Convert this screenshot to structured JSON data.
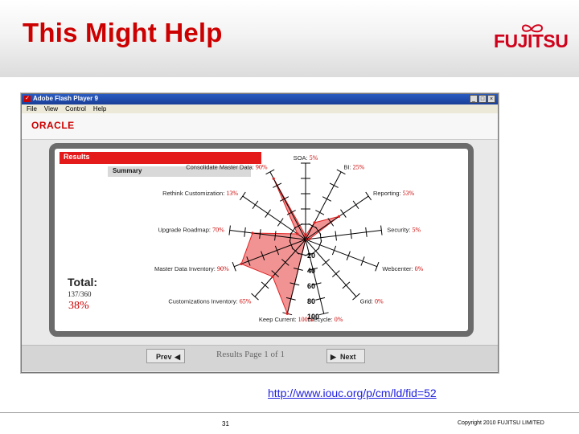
{
  "slide": {
    "title": "This Might Help",
    "logo_text": "FUJITSU",
    "url": "http://www.iouc.org/p/cm/ld/fid=52",
    "page_number": "31",
    "copyright": "Copyright 2010 FUJITSU LIMITED"
  },
  "window": {
    "title": "Adobe Flash Player 9",
    "menu": [
      "File",
      "View",
      "Control",
      "Help"
    ],
    "buttons": [
      "_",
      "□",
      "×"
    ]
  },
  "app": {
    "brand": "ORACLE",
    "results_label": "Results",
    "summary_label": "Summary",
    "total_label": "Total:",
    "total_score": "137/360",
    "total_percent": "38%",
    "prev_label": "Prev",
    "next_label": "Next",
    "page_indicator": "Results Page 1 of 1"
  },
  "chart_data": {
    "type": "radar",
    "axes": [
      {
        "label": "SOA:",
        "value": 5,
        "value_text": "5%"
      },
      {
        "label": "BI:",
        "value": 25,
        "value_text": "25%"
      },
      {
        "label": "Reporting:",
        "value": 53,
        "value_text": "53%"
      },
      {
        "label": "Security:",
        "value": 5,
        "value_text": "5%"
      },
      {
        "label": "Webcenter:",
        "value": 0,
        "value_text": "0%"
      },
      {
        "label": "Grid:",
        "value": 0,
        "value_text": "0%"
      },
      {
        "label": "Lifecycle:",
        "value": 0,
        "value_text": "0%"
      },
      {
        "label": "Keep Current:",
        "value": 100,
        "value_text": "100%"
      },
      {
        "label": "Customizations Inventory:",
        "value": 65,
        "value_text": "65%"
      },
      {
        "label": "Master Data Inventory:",
        "value": 90,
        "value_text": "90%"
      },
      {
        "label": "Upgrade Roadmap:",
        "value": 70,
        "value_text": "70%"
      },
      {
        "label": "Rethink Customization:",
        "value": 13,
        "value_text": "13%"
      },
      {
        "label": "Consolidate Master Data:",
        "value": 90,
        "value_text": "90%"
      }
    ],
    "scale_ticks": [
      "20",
      "40",
      "60",
      "80",
      "100"
    ],
    "range": [
      0,
      100
    ],
    "colors": {
      "fill": "#f08080",
      "stroke": "#e02020",
      "axis": "#000000",
      "value_text": "#cc0000"
    }
  }
}
